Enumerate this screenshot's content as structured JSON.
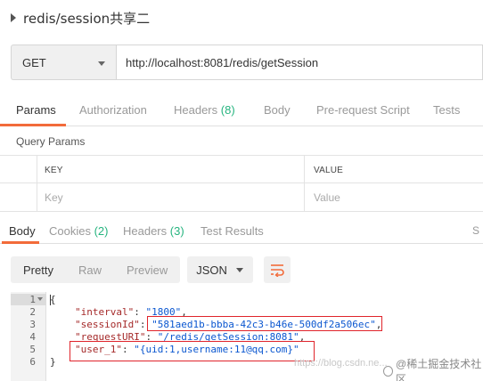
{
  "request": {
    "title": "redis/session共享二",
    "method": "GET",
    "url": "http://localhost:8081/redis/getSession"
  },
  "request_tabs": [
    {
      "label": "Params",
      "count": ""
    },
    {
      "label": "Authorization",
      "count": ""
    },
    {
      "label": "Headers",
      "count": "(8)"
    },
    {
      "label": "Body",
      "count": ""
    },
    {
      "label": "Pre-request Script",
      "count": ""
    },
    {
      "label": "Tests",
      "count": ""
    }
  ],
  "query_params": {
    "title": "Query Params",
    "key_header": "KEY",
    "value_header": "VALUE",
    "key_placeholder": "Key",
    "value_placeholder": "Value"
  },
  "response_tabs": [
    {
      "label": "Body",
      "count": ""
    },
    {
      "label": "Cookies",
      "count": "(2)"
    },
    {
      "label": "Headers",
      "count": "(3)"
    },
    {
      "label": "Test Results",
      "count": ""
    }
  ],
  "response_status_clip": "S",
  "format_buttons": [
    "Pretty",
    "Raw",
    "Preview"
  ],
  "format_type": "JSON",
  "response_body": {
    "line_numbers": [
      "1",
      "2",
      "3",
      "4",
      "5",
      "6"
    ],
    "open_brace": "{",
    "close_brace": "}",
    "fields": [
      {
        "key": "\"interval\"",
        "value": "\"1800\"",
        "trail": ","
      },
      {
        "key": "\"sessionId\"",
        "value": "\"581aed1b-bbba-42c3-b46e-500df2a506ec\"",
        "trail": ","
      },
      {
        "key": "\"requestURI\"",
        "value": "\"/redis/getSession:8081\"",
        "trail": ","
      },
      {
        "key": "\"user_1\"",
        "value": "\"{uid:1,username:11@qq.com}\"",
        "trail": ""
      }
    ]
  },
  "watermark": {
    "url_text": "https://blog.csdn.ne...",
    "brand": "@稀土掘金技术社区"
  },
  "colors": {
    "accent": "#f26b3a",
    "count_green": "#26b47f",
    "json_key": "#a52a2a",
    "json_string": "#0b57d0",
    "highlight_box": "#e0242b"
  }
}
